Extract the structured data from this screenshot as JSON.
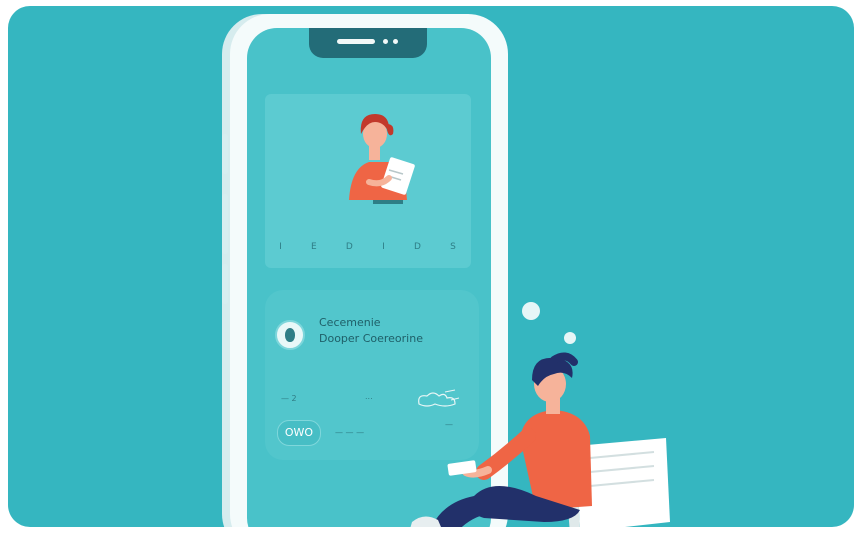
{
  "phone": {
    "profile_card": {
      "metric_labels": [
        "I",
        "E",
        "D",
        "I",
        "D",
        "S"
      ]
    },
    "list_card": {
      "entry_title": "Cecemenie",
      "entry_subtitle": "Dooper Coereorine",
      "stat_left": "— 2",
      "stat_right": "...",
      "badge_text": "OWO",
      "stat_left2": "— — —",
      "stat_right2": "—"
    }
  },
  "colors": {
    "background": "#35b6c0",
    "phone_frame": "#f4fbfb",
    "phone_screen": "#49c2c9",
    "shirt": "#ef6545",
    "pants": "#22306a"
  }
}
